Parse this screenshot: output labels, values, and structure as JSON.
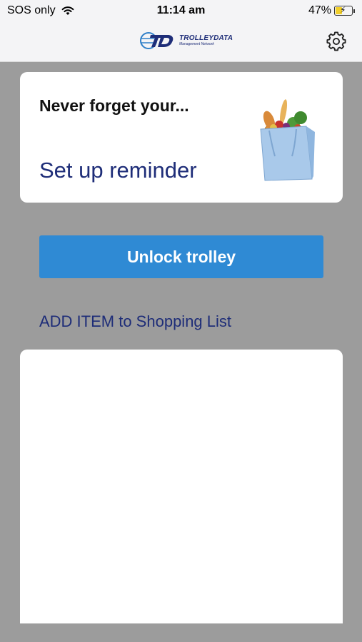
{
  "status_bar": {
    "carrier": "SOS only",
    "time": "11:14 am",
    "battery": "47%",
    "battery_level": 0.47
  },
  "header": {
    "logo_text": "TROLLEYDATA",
    "logo_tagline": "Management Network"
  },
  "reminder_card": {
    "heading": "Never forget your...",
    "link": "Set up reminder"
  },
  "unlock_button": {
    "label": "Unlock trolley"
  },
  "add_item": {
    "label": "ADD ITEM to Shopping List"
  },
  "colors": {
    "accent": "#2f8ad4",
    "navy": "#1e2d78",
    "background": "#9c9c9c"
  }
}
